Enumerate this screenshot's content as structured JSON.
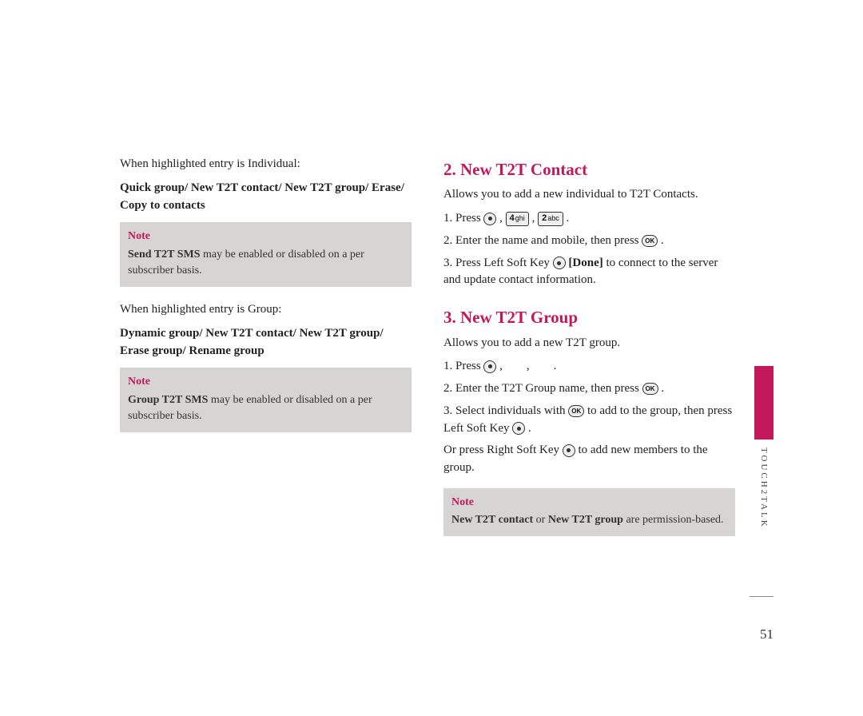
{
  "page_number": "51",
  "sidebar_label": "TOUCH2TALK",
  "left": {
    "p1": "When highlighted entry is Individual:",
    "p2": "Quick group/ New T2T contact/ New T2T group/ Erase/ Copy to contacts",
    "note1": {
      "title": "Note",
      "bold": "Send T2T SMS",
      "rest": " may be enabled or disabled on a per subscriber basis."
    },
    "p3": "When highlighted entry is Group:",
    "p4": "Dynamic group/ New T2T contact/ New T2T group/ Erase group/ Rename group",
    "note2": {
      "title": "Note",
      "bold": "Group T2T SMS",
      "rest": " may be enabled or disabled on a per subscriber basis."
    }
  },
  "right": {
    "h1": "2. New T2T Contact",
    "p1": "Allows you to add a new individual to T2T Contacts.",
    "s1_a": "1. Press ",
    "key4": "4 ghi",
    "key2": "2 abc",
    "s2_a": "2. Enter the name and mobile, then press ",
    "okLabel": "OK",
    "s3_a": "3. Press Left Soft Key ",
    "s3_b": "[Done]",
    "s3_c": " to connect to the server and update contact information.",
    "h2": "3. New T2T Group",
    "p2": "Allows you to add a new T2T group.",
    "g1_a": "1. Press ",
    "g2_a": "2. Enter the T2T Group name, then press ",
    "g3_a": "3. Select individuals with ",
    "g3_b": " to add to the group, then press Left Soft Key ",
    "g4_a": "Or press Right Soft Key ",
    "g4_b": " to add new members to the group.",
    "note": {
      "title": "Note",
      "bold1": "New T2T contact",
      "mid": " or ",
      "bold2": "New T2T group",
      "rest": " are permission-based."
    }
  }
}
